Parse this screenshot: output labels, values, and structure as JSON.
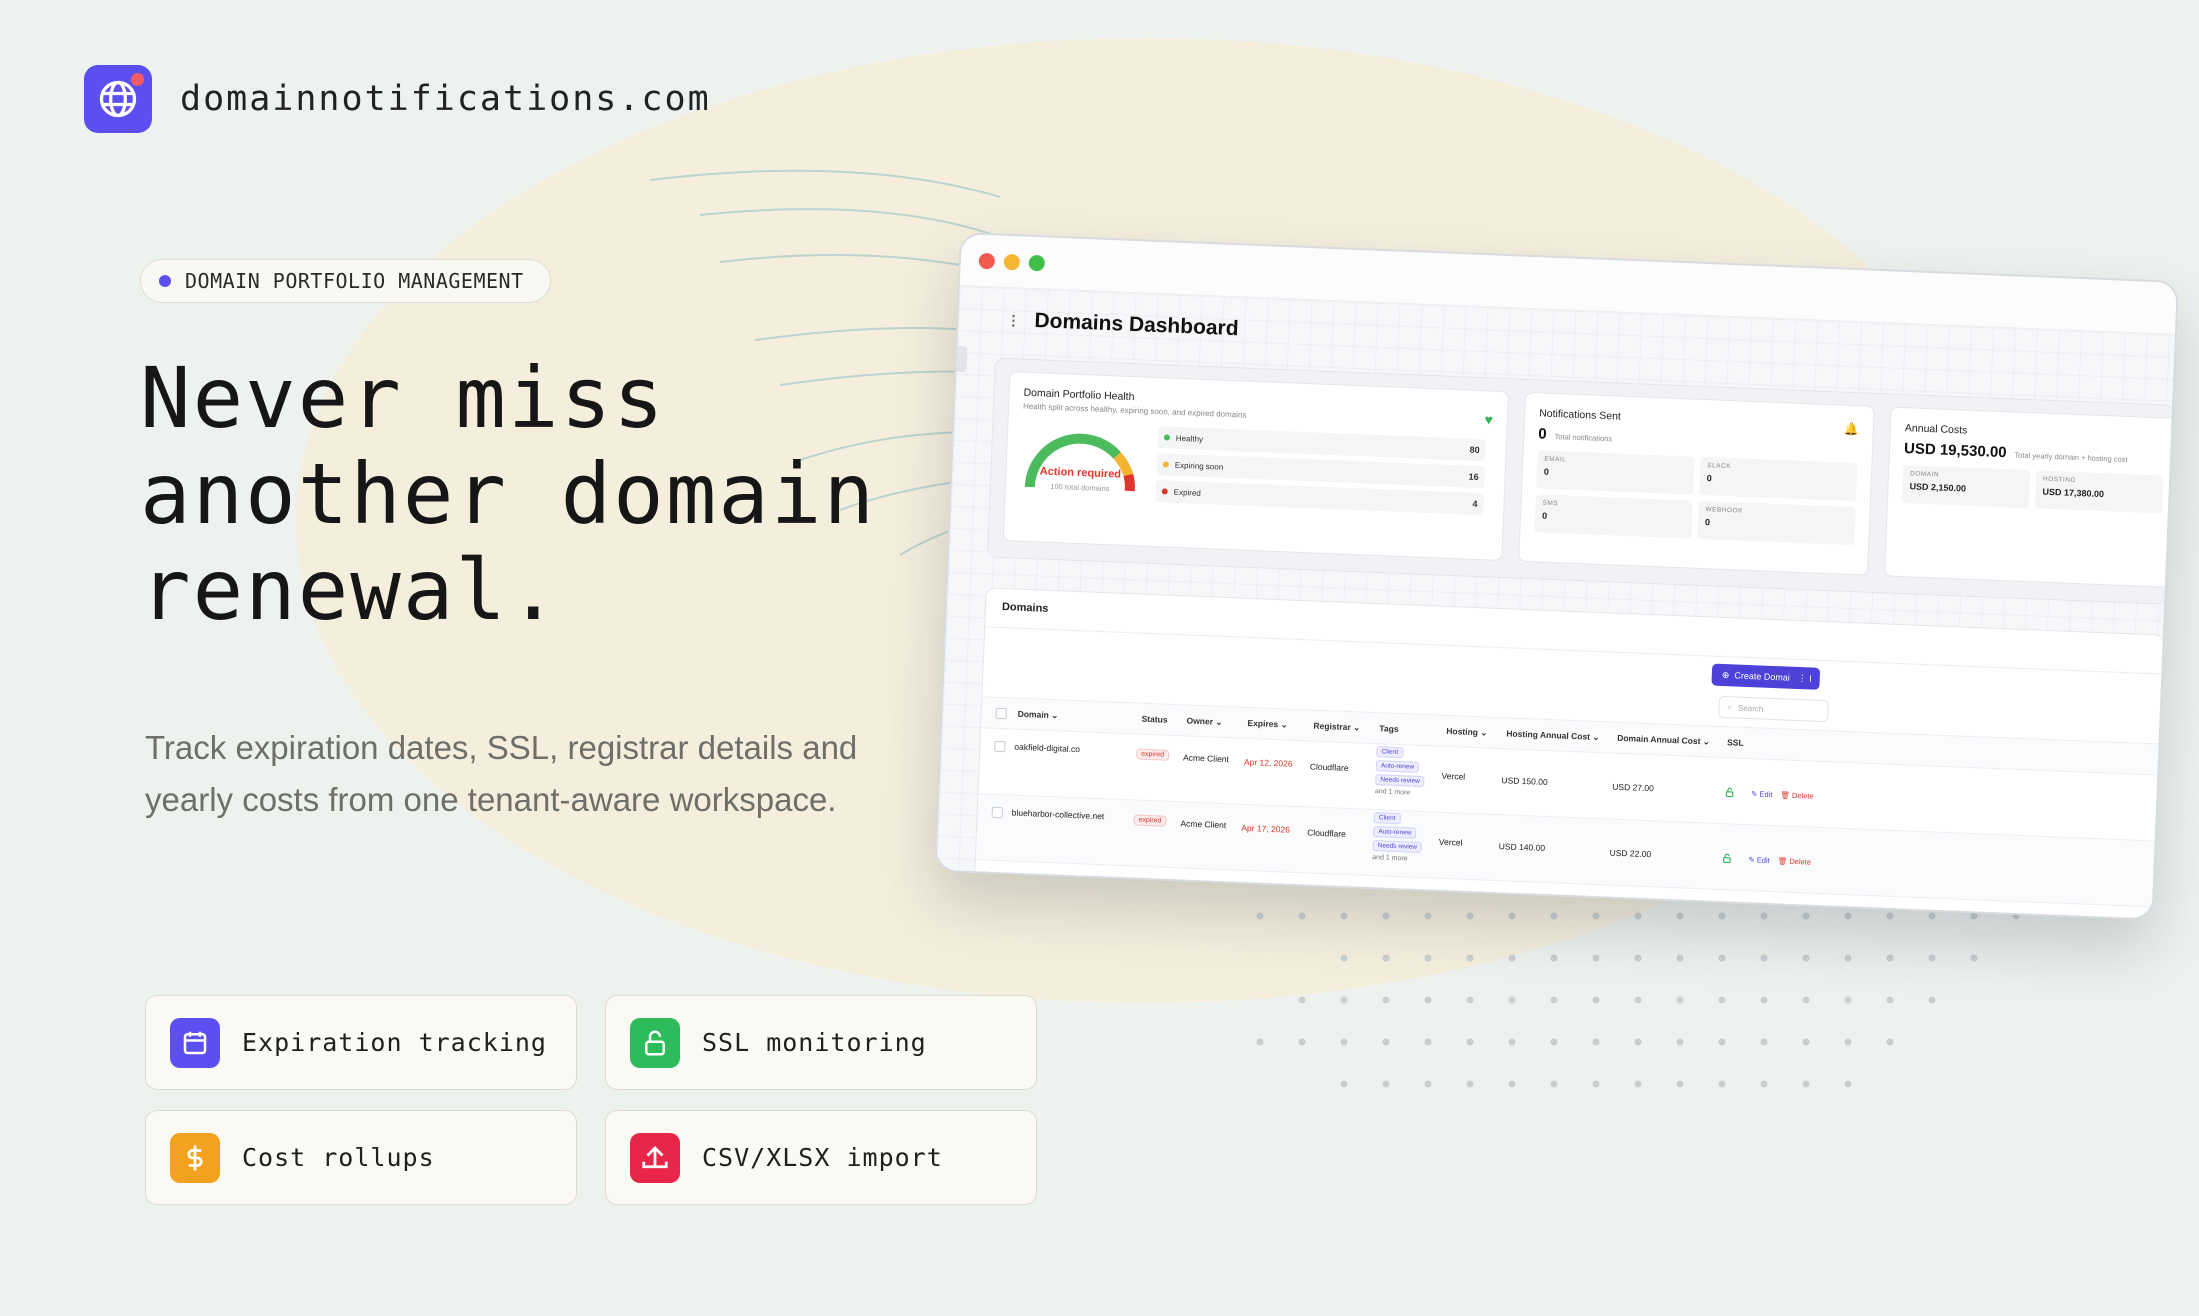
{
  "brand": {
    "name": "domainnotifications.com",
    "icon": "globe-icon",
    "accent": "#5b4ff0"
  },
  "hero": {
    "eyebrow": "DOMAIN PORTFOLIO MANAGEMENT",
    "headline_lines": [
      "Never miss",
      "another domain",
      "renewal."
    ],
    "subtext": "Track expiration dates, SSL, registrar details and yearly costs from one tenant-aware workspace."
  },
  "features": [
    {
      "label": "Expiration tracking",
      "icon": "calendar-icon",
      "color": "#5b4ff0"
    },
    {
      "label": "SSL monitoring",
      "icon": "lock-icon",
      "color": "#2dbb5c"
    },
    {
      "label": "Cost rollups",
      "icon": "dollar-icon",
      "color": "#f3a21f"
    },
    {
      "label": "CSV/XLSX import",
      "icon": "upload-icon",
      "color": "#e8264a"
    }
  ],
  "app": {
    "title": "Domains Dashboard",
    "health": {
      "title": "Domain Portfolio Health",
      "subtitle": "Health split across healthy, expiring soon, and expired domains",
      "gauge_label": "Action required",
      "gauge_sub": "100 total domains",
      "rows": [
        {
          "label": "Healthy",
          "value": "80",
          "color": "#4cbb5e"
        },
        {
          "label": "Expiring soon",
          "value": "16",
          "color": "#f2b530"
        },
        {
          "label": "Expired",
          "value": "4",
          "color": "#e0362c"
        }
      ]
    },
    "notifications": {
      "title": "Notifications Sent",
      "value": "0",
      "caption": "Total notifications",
      "channels": [
        {
          "key": "EMAIL",
          "value": "0"
        },
        {
          "key": "SLACK",
          "value": "0"
        },
        {
          "key": "SMS",
          "value": "0"
        },
        {
          "key": "WEBHOOK",
          "value": "0"
        }
      ]
    },
    "costs": {
      "title": "Annual Costs",
      "value": "USD 19,530.00",
      "caption": "Total yearly domain + hosting cost",
      "items": [
        {
          "key": "DOMAIN",
          "value": "USD 2,150.00"
        },
        {
          "key": "HOSTING",
          "value": "USD 17,380.00"
        }
      ]
    },
    "domains": {
      "title": "Domains",
      "create_label": "Create Domain",
      "more_label": "⋮ I",
      "search_placeholder": "Search",
      "columns": [
        "Domain",
        "Status",
        "Owner",
        "Expires",
        "Registrar",
        "Tags",
        "Hosting",
        "Hosting Annual Cost",
        "Domain Annual Cost",
        "SSL"
      ],
      "rows": [
        {
          "domain": "oakfield-digital.co",
          "status": "expired",
          "owner": "Acme Client",
          "expires": "Apr 12, 2026",
          "registrar": "Cloudflare",
          "tags": [
            "Client",
            "Auto-renew",
            "Needs review"
          ],
          "tags_more": "and 1 more",
          "hosting": "Vercel",
          "hosting_cost": "USD 150.00",
          "domain_cost": "USD 27.00",
          "edit": "Edit",
          "delete": "Delete"
        },
        {
          "domain": "blueharbor-collective.net",
          "status": "expired",
          "owner": "Acme Client",
          "expires": "Apr 17, 2026",
          "registrar": "Cloudflare",
          "tags": [
            "Client",
            "Auto-renew",
            "Needs review"
          ],
          "tags_more": "and 1 more",
          "hosting": "Vercel",
          "hosting_cost": "USD 140.00",
          "domain_cost": "USD 22.00",
          "edit": "Edit",
          "delete": "Delete"
        }
      ]
    }
  }
}
